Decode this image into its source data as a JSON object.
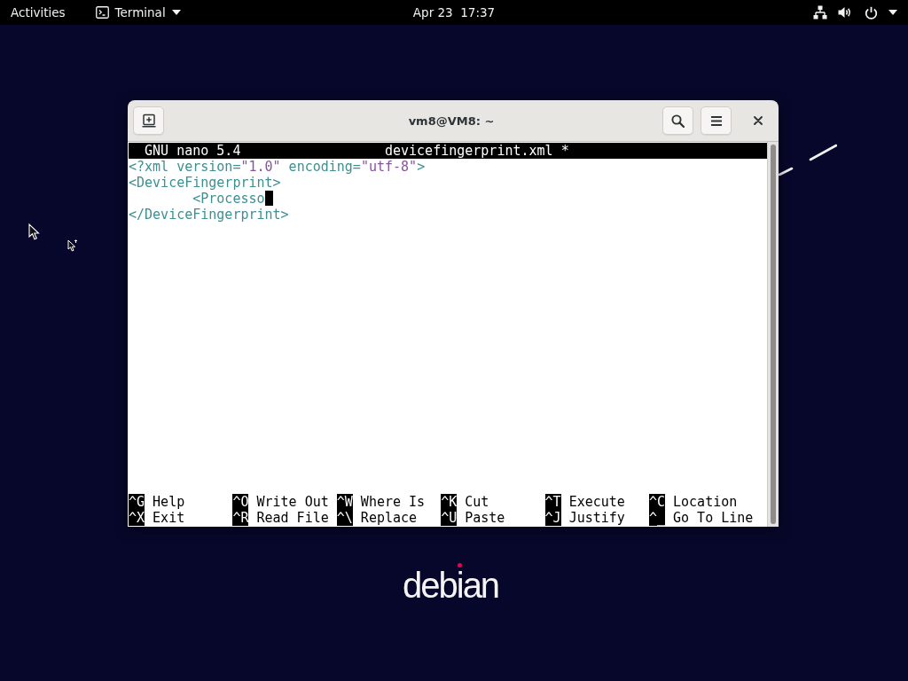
{
  "top_bar": {
    "activities": "Activities",
    "app_menu": "Terminal",
    "clock": "Apr 23  17:37"
  },
  "window": {
    "title": "vm8@VM8: ~"
  },
  "nano": {
    "title_bar": {
      "program": "GNU nano 5.4",
      "file": "devicefingerprint.xml *"
    },
    "lines": [
      {
        "segments": [
          {
            "text": "<?xml version=",
            "kind": "tag"
          },
          {
            "text": "\"1.0\"",
            "kind": "string"
          },
          {
            "text": " encoding=",
            "kind": "tag"
          },
          {
            "text": "\"utf-8\"",
            "kind": "string"
          },
          {
            "text": ">",
            "kind": "tag"
          }
        ],
        "cursor": false
      },
      {
        "segments": [
          {
            "text": "<DeviceFingerprint>",
            "kind": "tag"
          }
        ],
        "cursor": false,
        "children": [
          {
            "segments": [
              {
                "text": "<Processo",
                "kind": "tag"
              }
            ],
            "cursor": true
          }
        ]
      },
      {
        "segments": [
          {
            "text": "</DeviceFingerprint>",
            "kind": "tag"
          }
        ],
        "cursor": false
      }
    ],
    "shortcuts": [
      {
        "key": "^G",
        "label": "Help"
      },
      {
        "key": "^O",
        "label": "Write Out"
      },
      {
        "key": "^W",
        "label": "Where Is"
      },
      {
        "key": "^K",
        "label": "Cut"
      },
      {
        "key": "^T",
        "label": "Execute"
      },
      {
        "key": "^C",
        "label": "Location"
      },
      {
        "key": "^X",
        "label": "Exit"
      },
      {
        "key": "^R",
        "label": "Read File"
      },
      {
        "key": "^\\",
        "label": "Replace"
      },
      {
        "key": "^U",
        "label": "Paste"
      },
      {
        "key": "^J",
        "label": "Justify"
      },
      {
        "key": "^_",
        "label": "Go To Line"
      }
    ]
  },
  "desktop": {
    "logo": "debian"
  }
}
